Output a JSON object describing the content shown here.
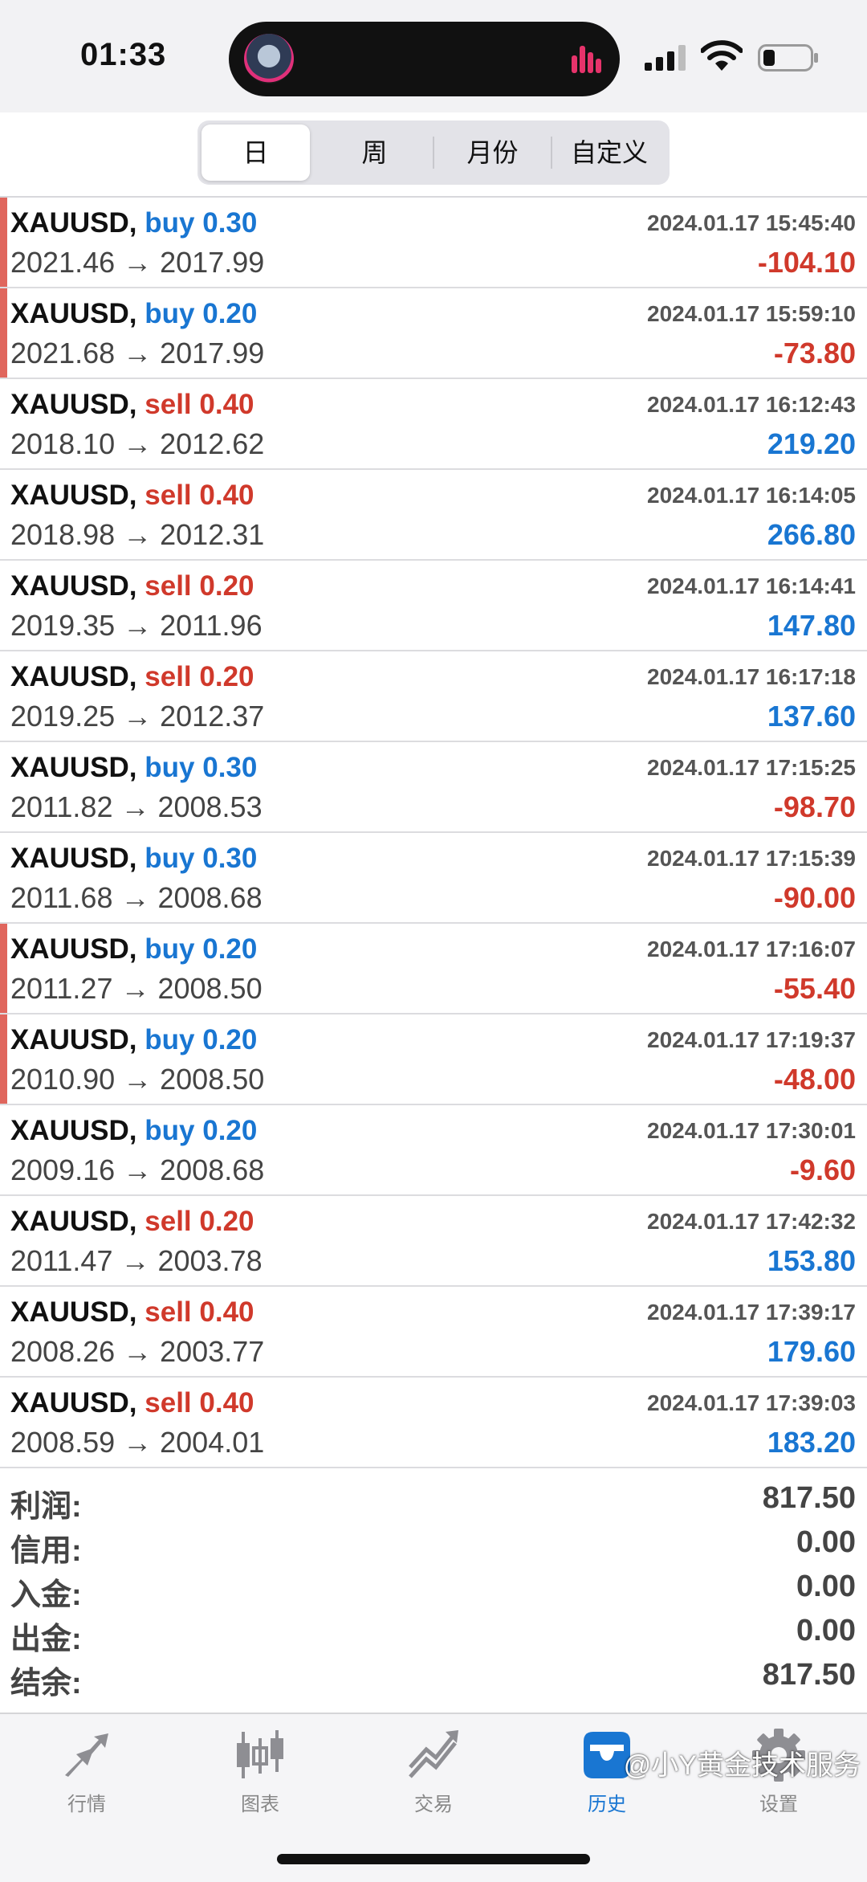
{
  "status": {
    "time": "01:33"
  },
  "segments": [
    "日",
    "周",
    "月份",
    "自定义"
  ],
  "trades": [
    {
      "symbol": "XAUUSD,",
      "side": "buy",
      "volume": "0.30",
      "time": "2024.01.17 15:45:40",
      "prices": "2021.46 → 2017.99",
      "profit": "-104.10",
      "flag": true
    },
    {
      "symbol": "XAUUSD,",
      "side": "buy",
      "volume": "0.20",
      "time": "2024.01.17 15:59:10",
      "prices": "2021.68 → 2017.99",
      "profit": "-73.80",
      "flag": true
    },
    {
      "symbol": "XAUUSD,",
      "side": "sell",
      "volume": "0.40",
      "time": "2024.01.17 16:12:43",
      "prices": "2018.10 → 2012.62",
      "profit": "219.20",
      "flag": false
    },
    {
      "symbol": "XAUUSD,",
      "side": "sell",
      "volume": "0.40",
      "time": "2024.01.17 16:14:05",
      "prices": "2018.98 → 2012.31",
      "profit": "266.80",
      "flag": false
    },
    {
      "symbol": "XAUUSD,",
      "side": "sell",
      "volume": "0.20",
      "time": "2024.01.17 16:14:41",
      "prices": "2019.35 → 2011.96",
      "profit": "147.80",
      "flag": false
    },
    {
      "symbol": "XAUUSD,",
      "side": "sell",
      "volume": "0.20",
      "time": "2024.01.17 16:17:18",
      "prices": "2019.25 → 2012.37",
      "profit": "137.60",
      "flag": false
    },
    {
      "symbol": "XAUUSD,",
      "side": "buy",
      "volume": "0.30",
      "time": "2024.01.17 17:15:25",
      "prices": "2011.82 → 2008.53",
      "profit": "-98.70",
      "flag": false
    },
    {
      "symbol": "XAUUSD,",
      "side": "buy",
      "volume": "0.30",
      "time": "2024.01.17 17:15:39",
      "prices": "2011.68 → 2008.68",
      "profit": "-90.00",
      "flag": false
    },
    {
      "symbol": "XAUUSD,",
      "side": "buy",
      "volume": "0.20",
      "time": "2024.01.17 17:16:07",
      "prices": "2011.27 → 2008.50",
      "profit": "-55.40",
      "flag": true
    },
    {
      "symbol": "XAUUSD,",
      "side": "buy",
      "volume": "0.20",
      "time": "2024.01.17 17:19:37",
      "prices": "2010.90 → 2008.50",
      "profit": "-48.00",
      "flag": true
    },
    {
      "symbol": "XAUUSD,",
      "side": "buy",
      "volume": "0.20",
      "time": "2024.01.17 17:30:01",
      "prices": "2009.16 → 2008.68",
      "profit": "-9.60",
      "flag": false
    },
    {
      "symbol": "XAUUSD,",
      "side": "sell",
      "volume": "0.20",
      "time": "2024.01.17 17:42:32",
      "prices": "2011.47 → 2003.78",
      "profit": "153.80",
      "flag": false
    },
    {
      "symbol": "XAUUSD,",
      "side": "sell",
      "volume": "0.40",
      "time": "2024.01.17 17:39:17",
      "prices": "2008.26 → 2003.77",
      "profit": "179.60",
      "flag": false
    },
    {
      "symbol": "XAUUSD,",
      "side": "sell",
      "volume": "0.40",
      "time": "2024.01.17 17:39:03",
      "prices": "2008.59 → 2004.01",
      "profit": "183.20",
      "flag": false
    }
  ],
  "summary": [
    {
      "label": "利润:",
      "value": "817.50"
    },
    {
      "label": "信用:",
      "value": "0.00"
    },
    {
      "label": "入金:",
      "value": "0.00"
    },
    {
      "label": "出金:",
      "value": "0.00"
    },
    {
      "label": "结余:",
      "value": "817.50"
    }
  ],
  "tabs": [
    {
      "label": "行情",
      "icon": "quotes-icon"
    },
    {
      "label": "图表",
      "icon": "chart-icon"
    },
    {
      "label": "交易",
      "icon": "trade-icon"
    },
    {
      "label": "历史",
      "icon": "history-icon",
      "active": true
    },
    {
      "label": "设置",
      "icon": "settings-icon"
    }
  ],
  "watermark": "@小Y黄金技术服务",
  "colors": {
    "buy": "#1976d2",
    "sell": "#d0392b",
    "accent": "#1976d2",
    "flag": "#e0665d"
  }
}
